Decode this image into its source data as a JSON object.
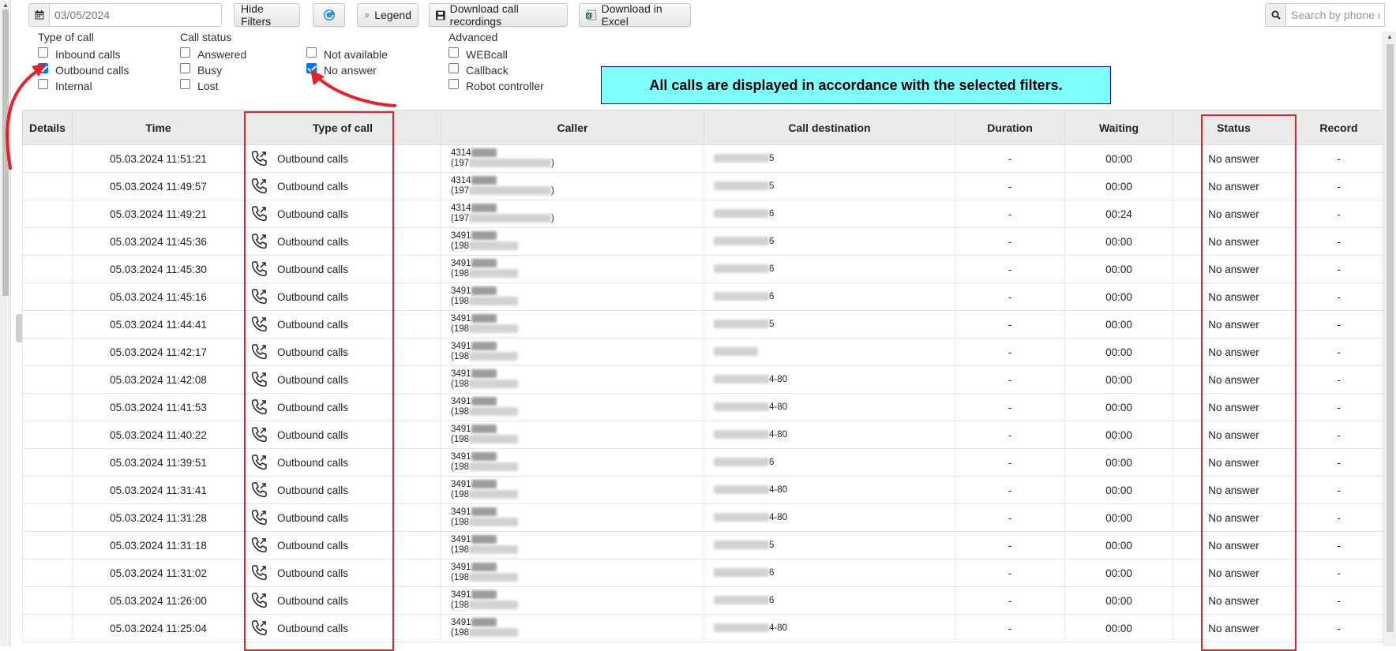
{
  "toolbar": {
    "date_value": "03/05/2024",
    "hide_filters_label": "Hide Filters",
    "legend_label": "Legend",
    "download_recordings_label": "Download call recordings",
    "download_excel_label": "Download in Excel",
    "search_placeholder": "Search by phone n",
    "icons": [
      "calendar-icon",
      "refresh-icon",
      "gear-icon",
      "floppy-disk-icon",
      "excel-icon",
      "search-icon"
    ]
  },
  "filters": {
    "type_of_call": {
      "title": "Type of call",
      "options": [
        {
          "label": "Inbound calls",
          "checked": false
        },
        {
          "label": "Outbound calls",
          "checked": true
        },
        {
          "label": "Internal",
          "checked": false
        }
      ]
    },
    "call_status": {
      "title": "Call status",
      "options": [
        {
          "label": "Answered",
          "checked": false
        },
        {
          "label": "Busy",
          "checked": false
        },
        {
          "label": "Lost",
          "checked": false
        },
        {
          "label": "Not available",
          "checked": false
        },
        {
          "label": "No answer",
          "checked": true
        }
      ]
    },
    "advanced": {
      "title": "Advanced",
      "options": [
        {
          "label": "WEBcall",
          "checked": false
        },
        {
          "label": "Callback",
          "checked": false
        },
        {
          "label": "Robot controller",
          "checked": false
        }
      ]
    }
  },
  "notice": "All calls are displayed in accordance with the selected filters.",
  "accent": {
    "highlight_red": "#e8202a",
    "notice_bg": "#80ffff",
    "checkbox_blue": "#0075ff"
  },
  "table": {
    "columns": [
      "Details",
      "Time",
      "Type of call",
      "Caller",
      "Call destination",
      "Duration",
      "Waiting",
      "Status",
      "Record"
    ],
    "rows": [
      {
        "time": "05.03.2024 11:51:21",
        "type": "Outbound calls",
        "caller_prefix": "4314",
        "caller_sub": "(197",
        "caller_tail": ")",
        "dest_tail": "5",
        "duration": "-",
        "waiting": "00:00",
        "status": "No answer",
        "record": "-"
      },
      {
        "time": "05.03.2024 11:49:57",
        "type": "Outbound calls",
        "caller_prefix": "4314",
        "caller_sub": "(197",
        "caller_tail": ")",
        "dest_tail": "5",
        "duration": "-",
        "waiting": "00:00",
        "status": "No answer",
        "record": "-"
      },
      {
        "time": "05.03.2024 11:49:21",
        "type": "Outbound calls",
        "caller_prefix": "4314",
        "caller_sub": "(197",
        "caller_tail": ")",
        "dest_tail": "6",
        "duration": "-",
        "waiting": "00:24",
        "status": "No answer",
        "record": "-"
      },
      {
        "time": "05.03.2024 11:45:36",
        "type": "Outbound calls",
        "caller_prefix": "3491",
        "caller_sub": "(198",
        "caller_tail": "",
        "dest_tail": "6",
        "duration": "-",
        "waiting": "00:00",
        "status": "No answer",
        "record": "-"
      },
      {
        "time": "05.03.2024 11:45:30",
        "type": "Outbound calls",
        "caller_prefix": "3491",
        "caller_sub": "(198",
        "caller_tail": "",
        "dest_tail": "6",
        "duration": "-",
        "waiting": "00:00",
        "status": "No answer",
        "record": "-"
      },
      {
        "time": "05.03.2024 11:45:16",
        "type": "Outbound calls",
        "caller_prefix": "3491",
        "caller_sub": "(198",
        "caller_tail": "",
        "dest_tail": "6",
        "duration": "-",
        "waiting": "00:00",
        "status": "No answer",
        "record": "-"
      },
      {
        "time": "05.03.2024 11:44:41",
        "type": "Outbound calls",
        "caller_prefix": "3491",
        "caller_sub": "(198",
        "caller_tail": "",
        "dest_tail": "5",
        "duration": "-",
        "waiting": "00:00",
        "status": "No answer",
        "record": "-"
      },
      {
        "time": "05.03.2024 11:42:17",
        "type": "Outbound calls",
        "caller_prefix": "3491",
        "caller_sub": "(198",
        "caller_tail": "",
        "dest_tail": "",
        "duration": "-",
        "waiting": "00:00",
        "status": "No answer",
        "record": "-"
      },
      {
        "time": "05.03.2024 11:42:08",
        "type": "Outbound calls",
        "caller_prefix": "3491",
        "caller_sub": "(198",
        "caller_tail": "",
        "dest_tail": "4-80",
        "duration": "-",
        "waiting": "00:00",
        "status": "No answer",
        "record": "-"
      },
      {
        "time": "05.03.2024 11:41:53",
        "type": "Outbound calls",
        "caller_prefix": "3491",
        "caller_sub": "(198",
        "caller_tail": "",
        "dest_tail": "4-80",
        "duration": "-",
        "waiting": "00:00",
        "status": "No answer",
        "record": "-"
      },
      {
        "time": "05.03.2024 11:40:22",
        "type": "Outbound calls",
        "caller_prefix": "3491",
        "caller_sub": "(198",
        "caller_tail": "",
        "dest_tail": "4-80",
        "duration": "-",
        "waiting": "00:00",
        "status": "No answer",
        "record": "-"
      },
      {
        "time": "05.03.2024 11:39:51",
        "type": "Outbound calls",
        "caller_prefix": "3491",
        "caller_sub": "(198",
        "caller_tail": "",
        "dest_tail": "6",
        "duration": "-",
        "waiting": "00:00",
        "status": "No answer",
        "record": "-"
      },
      {
        "time": "05.03.2024 11:31:41",
        "type": "Outbound calls",
        "caller_prefix": "3491",
        "caller_sub": "(198",
        "caller_tail": "",
        "dest_tail": "4-80",
        "duration": "-",
        "waiting": "00:00",
        "status": "No answer",
        "record": "-"
      },
      {
        "time": "05.03.2024 11:31:28",
        "type": "Outbound calls",
        "caller_prefix": "3491",
        "caller_sub": "(198",
        "caller_tail": "",
        "dest_tail": "4-80",
        "duration": "-",
        "waiting": "00:00",
        "status": "No answer",
        "record": "-"
      },
      {
        "time": "05.03.2024 11:31:18",
        "type": "Outbound calls",
        "caller_prefix": "3491",
        "caller_sub": "(198",
        "caller_tail": "",
        "dest_tail": "5",
        "duration": "-",
        "waiting": "00:00",
        "status": "No answer",
        "record": "-"
      },
      {
        "time": "05.03.2024 11:31:02",
        "type": "Outbound calls",
        "caller_prefix": "3491",
        "caller_sub": "(198",
        "caller_tail": "",
        "dest_tail": "6",
        "duration": "-",
        "waiting": "00:00",
        "status": "No answer",
        "record": "-"
      },
      {
        "time": "05.03.2024 11:26:00",
        "type": "Outbound calls",
        "caller_prefix": "3491",
        "caller_sub": "(198",
        "caller_tail": "",
        "dest_tail": "6",
        "duration": "-",
        "waiting": "00:00",
        "status": "No answer",
        "record": "-"
      },
      {
        "time": "05.03.2024 11:25:04",
        "type": "Outbound calls",
        "caller_prefix": "3491",
        "caller_sub": "(198",
        "caller_tail": "",
        "dest_tail": "4-80",
        "duration": "-",
        "waiting": "00:00",
        "status": "No answer",
        "record": "-"
      }
    ]
  }
}
